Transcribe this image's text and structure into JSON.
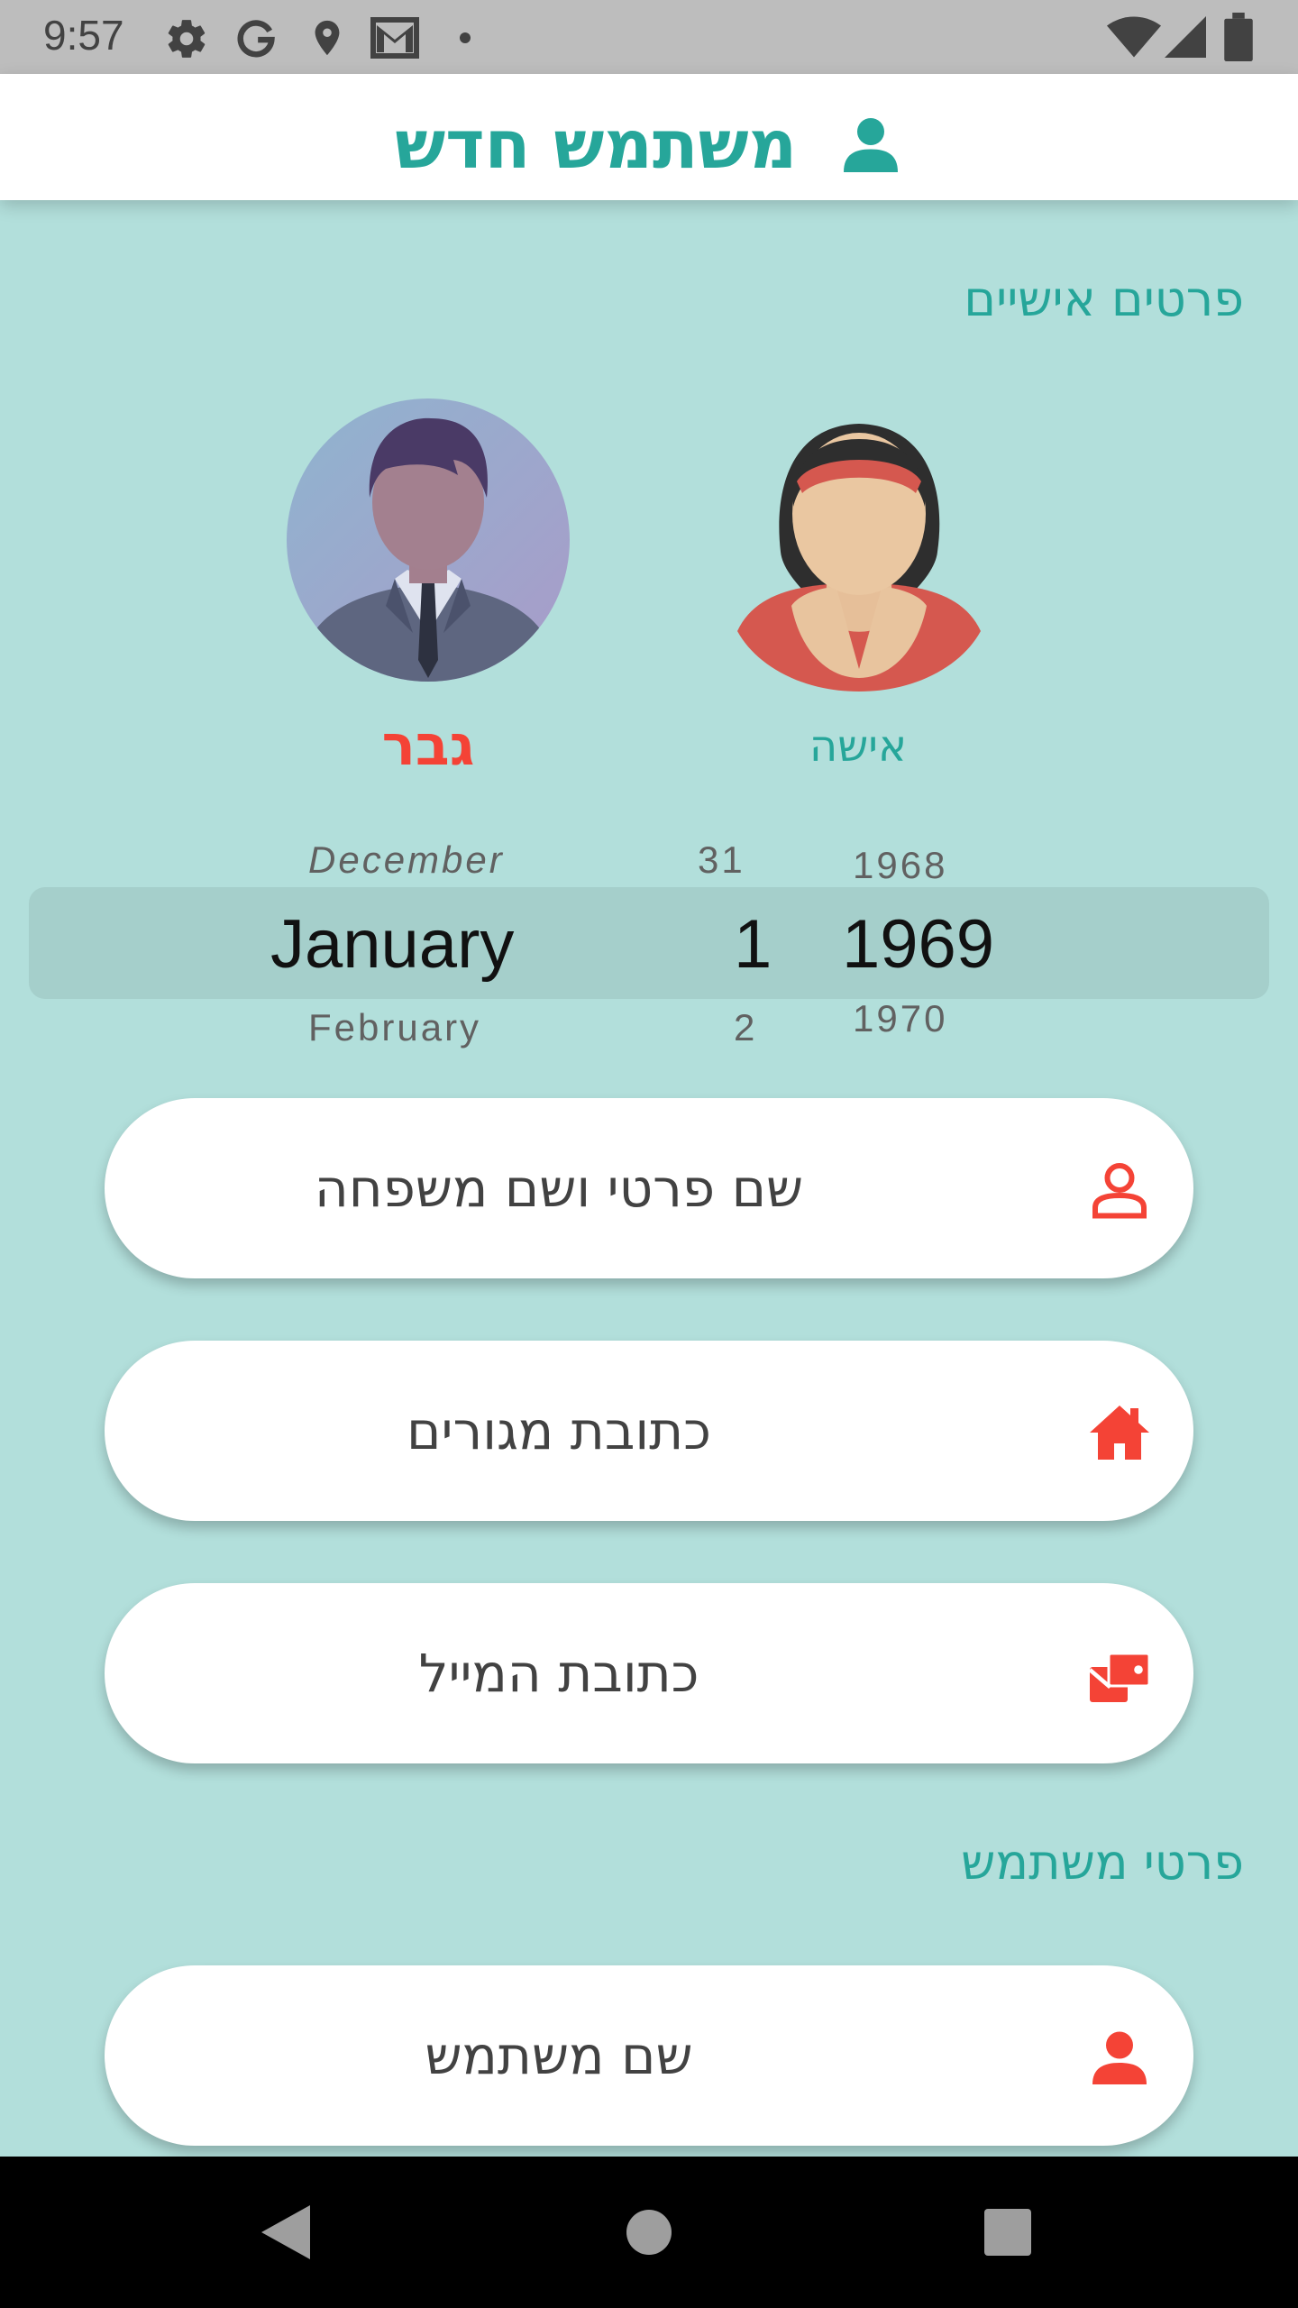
{
  "status_bar": {
    "time": "9:57",
    "icons": [
      "settings-icon",
      "google-icon",
      "location-icon",
      "gmail-icon",
      "dot-icon",
      "wifi-icon",
      "signal-icon",
      "battery-icon"
    ]
  },
  "app_bar": {
    "title": "משתמש חדש",
    "icon": "user-icon",
    "accent": "#26a69a"
  },
  "personal_section": {
    "title": "פרטים אישיים"
  },
  "gender": {
    "male_label": "גבר",
    "female_label": "אישה",
    "selected": "male",
    "selected_color": "#f44336",
    "unselected_color": "#26a69a"
  },
  "date_picker": {
    "month_prev": "December",
    "month": "January",
    "month_next": "February",
    "day_prev": "31",
    "day": "1",
    "day_next": "2",
    "year_prev": "1968",
    "year": "1969",
    "year_next": "1970"
  },
  "fields": [
    {
      "label": "שם פרטי ושם משפחה",
      "icon": "person-outline-icon"
    },
    {
      "label": "כתובת מגורים",
      "icon": "home-icon"
    },
    {
      "label": "כתובת המייל",
      "icon": "email-icon"
    }
  ],
  "user_section": {
    "title": "פרטי משתמש"
  },
  "user_fields": [
    {
      "label": "שם משתמש",
      "icon": "person-icon"
    }
  ],
  "nav_bar": {
    "icons": [
      "back-icon",
      "home-circle-icon",
      "recents-icon"
    ]
  },
  "colors": {
    "background": "#b2dfdb",
    "icon_red": "#f44336"
  }
}
